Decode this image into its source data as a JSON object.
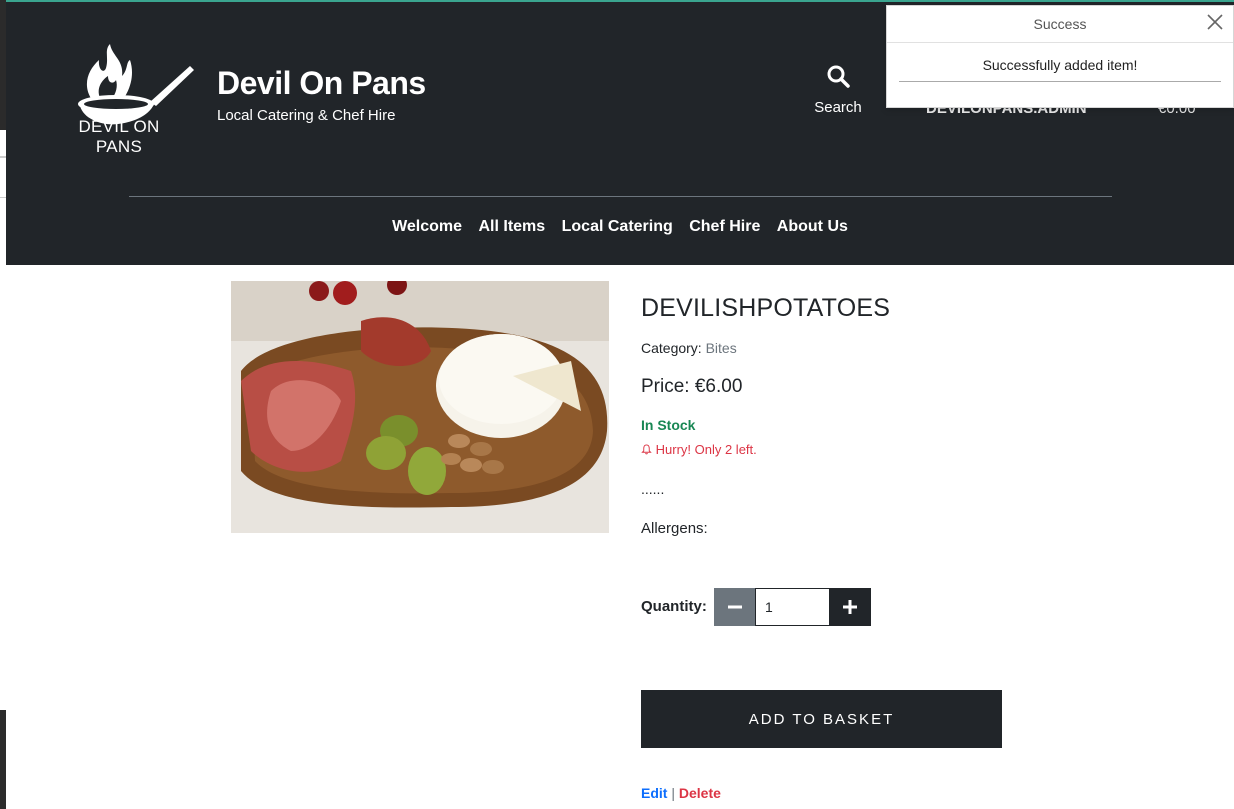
{
  "header": {
    "logo_text": "DEVIL ON PANS",
    "brand_title": "Devil On Pans",
    "brand_subtitle": "Local Catering & Chef Hire",
    "search_label": "Search",
    "account_label": "DEVILONPANS.ADMIN",
    "basket_total": "€0.00"
  },
  "nav": {
    "items": [
      "Welcome",
      "All Items",
      "Local Catering",
      "Chef Hire",
      "About Us"
    ]
  },
  "toast": {
    "title": "Success",
    "message": "Successfully added item!"
  },
  "product": {
    "name": "DEVILISHPOTATOES",
    "category_label": "Category: ",
    "category": "Bites",
    "price": "Price: €6.00",
    "stock": "In Stock",
    "hurry": "Hurry! Only 2 left.",
    "description": "......",
    "allergens": "Allergens:"
  },
  "quantity": {
    "label": "Quantity:",
    "value": "1"
  },
  "actions": {
    "add_to_basket": "ADD TO BASKET",
    "edit": "Edit",
    "separator": "|",
    "delete": "Delete"
  },
  "icons": {
    "search": "search-icon",
    "close": "close-icon",
    "bell": "bell-icon",
    "minus": "minus-icon",
    "plus": "plus-icon"
  }
}
